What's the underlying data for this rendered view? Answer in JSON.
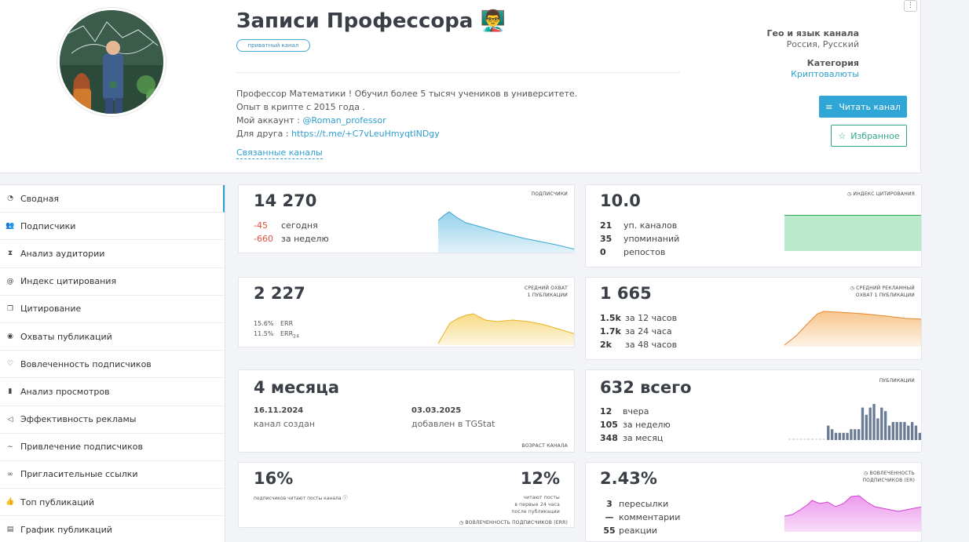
{
  "channel": {
    "title": "Записи Профессора 👨‍🏫",
    "badge": "приватный канал",
    "description": [
      "Профессор Математики ! Обучил более 5 тысяч учеников в университете.",
      "Опыт в крипте с 2015 года ."
    ],
    "account_label": "Мой аккаунт : ",
    "account_link": "@Roman_professor",
    "friend_label": "Для друга : ",
    "friend_link": "https://t.me/+C7vLeuHmyqtINDgy",
    "related": "Связанные каналы",
    "menu": "⋮"
  },
  "meta": {
    "geo_label": "Гео и язык канала",
    "geo_value": "Россия, Русский",
    "category_label": "Категория",
    "category_value": "Криптовалюты",
    "read_button": "Читать канал",
    "favorite_button": "Избранное"
  },
  "sidebar": {
    "items": [
      {
        "label": "Сводная",
        "icon": "dashboard-icon",
        "glyph": "◔"
      },
      {
        "label": "Подписчики",
        "icon": "users-icon",
        "glyph": "👥"
      },
      {
        "label": "Анализ аудитории",
        "icon": "hourglass-icon",
        "glyph": "⧗"
      },
      {
        "label": "Индекс цитирования",
        "icon": "at-icon",
        "glyph": "@"
      },
      {
        "label": "Цитирование",
        "icon": "quote-icon",
        "glyph": "❐"
      },
      {
        "label": "Охваты публикаций",
        "icon": "eye-icon",
        "glyph": "◉"
      },
      {
        "label": "Вовлеченность подписчиков",
        "icon": "heart-icon",
        "glyph": "♡"
      },
      {
        "label": "Анализ просмотров",
        "icon": "bar-chart-icon",
        "glyph": "▮"
      },
      {
        "label": "Эффективность рекламы",
        "icon": "megaphone-icon",
        "glyph": "◁"
      },
      {
        "label": "Привлечение подписчиков",
        "icon": "trend-icon",
        "glyph": "∼"
      },
      {
        "label": "Пригласительные ссылки",
        "icon": "link-icon",
        "glyph": "∞"
      },
      {
        "label": "Топ публикаций",
        "icon": "thumbs-up-icon",
        "glyph": "👍"
      },
      {
        "label": "График публикаций",
        "icon": "calendar-icon",
        "glyph": "▤"
      }
    ]
  },
  "subscribers": {
    "tag": "подписчики",
    "value": "14 270",
    "today_value": "-45",
    "today_label": "сегодня",
    "week_value": "-660",
    "week_label": "за неделю",
    "color": "#4bb3de"
  },
  "citation": {
    "tag": "индекс цитирования",
    "value": "10.0",
    "rows": [
      {
        "value": "21",
        "label": "уп. каналов"
      },
      {
        "value": "35",
        "label": "упоминаний"
      },
      {
        "value": "0",
        "label": "репостов"
      }
    ],
    "color": "#3cc06a"
  },
  "reach": {
    "tag1": "средний охват",
    "tag2": "1 публикации",
    "value": "2 227",
    "err_value": "15.6%",
    "err_label": "ERR",
    "err24_value": "11.5%",
    "err24_label": "ERR",
    "err24_sub": "24",
    "color": "#f2c230"
  },
  "ad_reach": {
    "tag1": "средний рекламный",
    "tag2": "охват 1 публикации",
    "value": "1 665",
    "rows": [
      {
        "value": "1.5k",
        "label": "за 12 часов"
      },
      {
        "value": "1.7k",
        "label": "за 24 часа"
      },
      {
        "value": "2k",
        "label": "за 48 часов"
      }
    ],
    "color": "#f0962e"
  },
  "age": {
    "value": "4 месяца",
    "created_date": "16.11.2024",
    "created_label": "канал создан",
    "added_date": "03.03.2025",
    "added_label": "добавлен в TGStat",
    "tag": "возраст канала"
  },
  "posts": {
    "tag": "публикации",
    "value": "632 всего",
    "rows": [
      {
        "value": "12",
        "label": "вчера"
      },
      {
        "value": "105",
        "label": "за неделю"
      },
      {
        "value": "348",
        "label": "за месяц"
      }
    ],
    "bars": [
      0,
      0,
      0,
      0,
      0,
      0,
      0,
      0,
      0,
      0,
      4,
      3,
      2,
      2,
      2,
      2,
      3,
      3,
      3,
      9,
      7,
      9,
      10,
      6,
      9,
      8,
      4,
      5,
      5,
      5,
      5,
      4,
      5,
      4,
      2
    ],
    "color": "#6b7d96"
  },
  "engagement_left": {
    "value_left": "16%",
    "label_left": "подписчиков читают посты канала",
    "value_right": "12%",
    "label_right": [
      "читают посты",
      "в первые 24 часа",
      "после публикации"
    ],
    "tag": "вовлеченность подписчиков (ERR)"
  },
  "engagement_right": {
    "tag1": "вовлеченность",
    "tag2": "подписчиков (ER)",
    "value": "2.43%",
    "rows": [
      {
        "value": "3",
        "label": "пересылки"
      },
      {
        "value": "—",
        "label": "комментарии"
      },
      {
        "value": "55",
        "label": "реакции"
      }
    ],
    "color": "#e055e0"
  }
}
